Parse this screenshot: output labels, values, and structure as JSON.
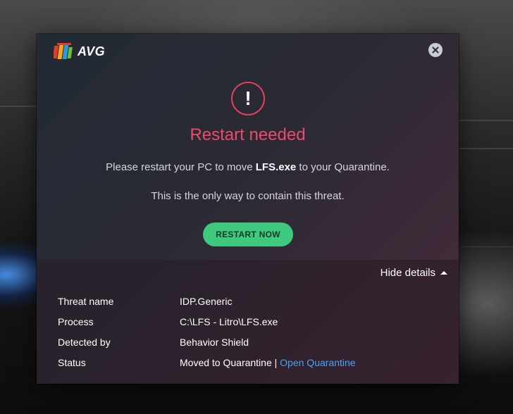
{
  "app": {
    "logo_text": "AVG"
  },
  "alert": {
    "icon_glyph": "!",
    "headline": "Restart needed",
    "message_prefix": "Please restart your PC to move ",
    "message_file": "LFS.exe",
    "message_suffix": " to your Quarantine.",
    "message2": "This is the only way to contain this threat.",
    "restart_label": "RESTART NOW"
  },
  "details": {
    "toggle_label": "Hide details",
    "rows": [
      {
        "label": "Threat name",
        "value": "IDP.Generic"
      },
      {
        "label": "Process",
        "value": "C:\\LFS - Litro\\LFS.exe"
      },
      {
        "label": "Detected by",
        "value": "Behavior Shield"
      },
      {
        "label": "Status",
        "value": "Moved to Quarantine",
        "separator": " | ",
        "link": "Open Quarantine"
      }
    ]
  },
  "colors": {
    "accent_red": "#ef4b69",
    "button_green": "#3fc97f",
    "link_blue": "#4aa3f0"
  },
  "icons": {
    "close": "close-icon",
    "alert": "exclamation-icon",
    "toggle": "caret-up-icon"
  }
}
